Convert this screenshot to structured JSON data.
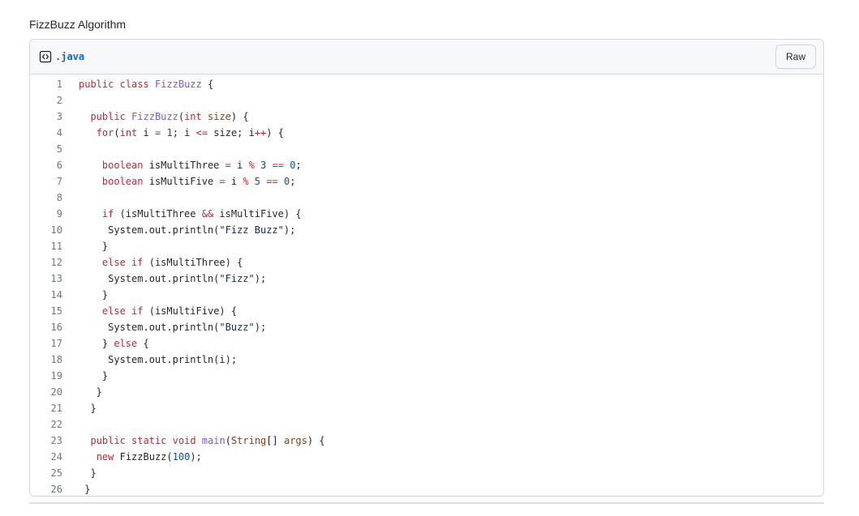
{
  "page": {
    "title": "FizzBuzz Algorithm"
  },
  "file": {
    "name": ".java",
    "raw_label": "Raw",
    "icon": "code-file-icon"
  },
  "colors": {
    "keyword": "#cf222e",
    "entity": "#8250df",
    "number": "#0550ae",
    "string": "#0a3069",
    "parameter": "#953800",
    "plain": "#1f2328",
    "line_number": "#6e7781",
    "link": "#0969da"
  },
  "code_lines": [
    {
      "num": "1",
      "tokens": [
        [
          "kw",
          "public"
        ],
        [
          "plain",
          " "
        ],
        [
          "kw",
          "class"
        ],
        [
          "plain",
          " "
        ],
        [
          "ent",
          "FizzBuzz"
        ],
        [
          "plain",
          " {"
        ]
      ]
    },
    {
      "num": "2",
      "tokens": []
    },
    {
      "num": "3",
      "tokens": [
        [
          "plain",
          "  "
        ],
        [
          "kw",
          "public"
        ],
        [
          "plain",
          " "
        ],
        [
          "ent",
          "FizzBuzz"
        ],
        [
          "plain",
          "("
        ],
        [
          "kw",
          "int"
        ],
        [
          "plain",
          " "
        ],
        [
          "prm",
          "size"
        ],
        [
          "plain",
          ") {"
        ]
      ]
    },
    {
      "num": "4",
      "tokens": [
        [
          "plain",
          "   "
        ],
        [
          "kw",
          "for"
        ],
        [
          "plain",
          "("
        ],
        [
          "kw",
          "int"
        ],
        [
          "plain",
          " i "
        ],
        [
          "op",
          "="
        ],
        [
          "plain",
          " "
        ],
        [
          "num",
          "1"
        ],
        [
          "plain",
          "; i "
        ],
        [
          "op",
          "<="
        ],
        [
          "plain",
          " size; i"
        ],
        [
          "op",
          "++"
        ],
        [
          "plain",
          ") {"
        ]
      ]
    },
    {
      "num": "5",
      "tokens": []
    },
    {
      "num": "6",
      "tokens": [
        [
          "plain",
          "    "
        ],
        [
          "kw",
          "boolean"
        ],
        [
          "plain",
          " isMultiThree "
        ],
        [
          "op",
          "="
        ],
        [
          "plain",
          " i "
        ],
        [
          "op",
          "%"
        ],
        [
          "plain",
          " "
        ],
        [
          "num",
          "3"
        ],
        [
          "plain",
          " "
        ],
        [
          "op",
          "=="
        ],
        [
          "plain",
          " "
        ],
        [
          "num",
          "0"
        ],
        [
          "plain",
          ";"
        ]
      ]
    },
    {
      "num": "7",
      "tokens": [
        [
          "plain",
          "    "
        ],
        [
          "kw",
          "boolean"
        ],
        [
          "plain",
          " isMultiFive "
        ],
        [
          "op",
          "="
        ],
        [
          "plain",
          " i "
        ],
        [
          "op",
          "%"
        ],
        [
          "plain",
          " "
        ],
        [
          "num",
          "5"
        ],
        [
          "plain",
          " "
        ],
        [
          "op",
          "=="
        ],
        [
          "plain",
          " "
        ],
        [
          "num",
          "0"
        ],
        [
          "plain",
          ";"
        ]
      ]
    },
    {
      "num": "8",
      "tokens": []
    },
    {
      "num": "9",
      "tokens": [
        [
          "plain",
          "    "
        ],
        [
          "kw",
          "if"
        ],
        [
          "plain",
          " (isMultiThree "
        ],
        [
          "op",
          "&&"
        ],
        [
          "plain",
          " isMultiFive) {"
        ]
      ]
    },
    {
      "num": "10",
      "tokens": [
        [
          "plain",
          "     System.out.println("
        ],
        [
          "str",
          "\"Fizz Buzz\""
        ],
        [
          "plain",
          ");"
        ]
      ]
    },
    {
      "num": "11",
      "tokens": [
        [
          "plain",
          "    }"
        ]
      ]
    },
    {
      "num": "12",
      "tokens": [
        [
          "plain",
          "    "
        ],
        [
          "kw",
          "else"
        ],
        [
          "plain",
          " "
        ],
        [
          "kw",
          "if"
        ],
        [
          "plain",
          " (isMultiThree) {"
        ]
      ]
    },
    {
      "num": "13",
      "tokens": [
        [
          "plain",
          "     System.out.println("
        ],
        [
          "str",
          "\"Fizz\""
        ],
        [
          "plain",
          ");"
        ]
      ]
    },
    {
      "num": "14",
      "tokens": [
        [
          "plain",
          "    }"
        ]
      ]
    },
    {
      "num": "15",
      "tokens": [
        [
          "plain",
          "    "
        ],
        [
          "kw",
          "else"
        ],
        [
          "plain",
          " "
        ],
        [
          "kw",
          "if"
        ],
        [
          "plain",
          " (isMultiFive) {"
        ]
      ]
    },
    {
      "num": "16",
      "tokens": [
        [
          "plain",
          "     System.out.println("
        ],
        [
          "str",
          "\"Buzz\""
        ],
        [
          "plain",
          ");"
        ]
      ]
    },
    {
      "num": "17",
      "tokens": [
        [
          "plain",
          "    } "
        ],
        [
          "kw",
          "else"
        ],
        [
          "plain",
          " {"
        ]
      ]
    },
    {
      "num": "18",
      "tokens": [
        [
          "plain",
          "     System.out.println(i);"
        ]
      ]
    },
    {
      "num": "19",
      "tokens": [
        [
          "plain",
          "    }"
        ]
      ]
    },
    {
      "num": "20",
      "tokens": [
        [
          "plain",
          "   }"
        ]
      ]
    },
    {
      "num": "21",
      "tokens": [
        [
          "plain",
          "  }"
        ]
      ]
    },
    {
      "num": "22",
      "tokens": []
    },
    {
      "num": "23",
      "tokens": [
        [
          "plain",
          "  "
        ],
        [
          "kw",
          "public"
        ],
        [
          "plain",
          " "
        ],
        [
          "kw",
          "static"
        ],
        [
          "plain",
          " "
        ],
        [
          "kw",
          "void"
        ],
        [
          "plain",
          " "
        ],
        [
          "ent",
          "main"
        ],
        [
          "plain",
          "("
        ],
        [
          "prm",
          "String"
        ],
        [
          "plain",
          "[] "
        ],
        [
          "prm",
          "args"
        ],
        [
          "plain",
          ") {"
        ]
      ]
    },
    {
      "num": "24",
      "tokens": [
        [
          "plain",
          "   "
        ],
        [
          "kw",
          "new"
        ],
        [
          "plain",
          " FizzBuzz("
        ],
        [
          "num",
          "100"
        ],
        [
          "plain",
          ");"
        ]
      ]
    },
    {
      "num": "25",
      "tokens": [
        [
          "plain",
          "  }"
        ]
      ]
    },
    {
      "num": "26",
      "tokens": [
        [
          "plain",
          " }"
        ]
      ]
    }
  ]
}
